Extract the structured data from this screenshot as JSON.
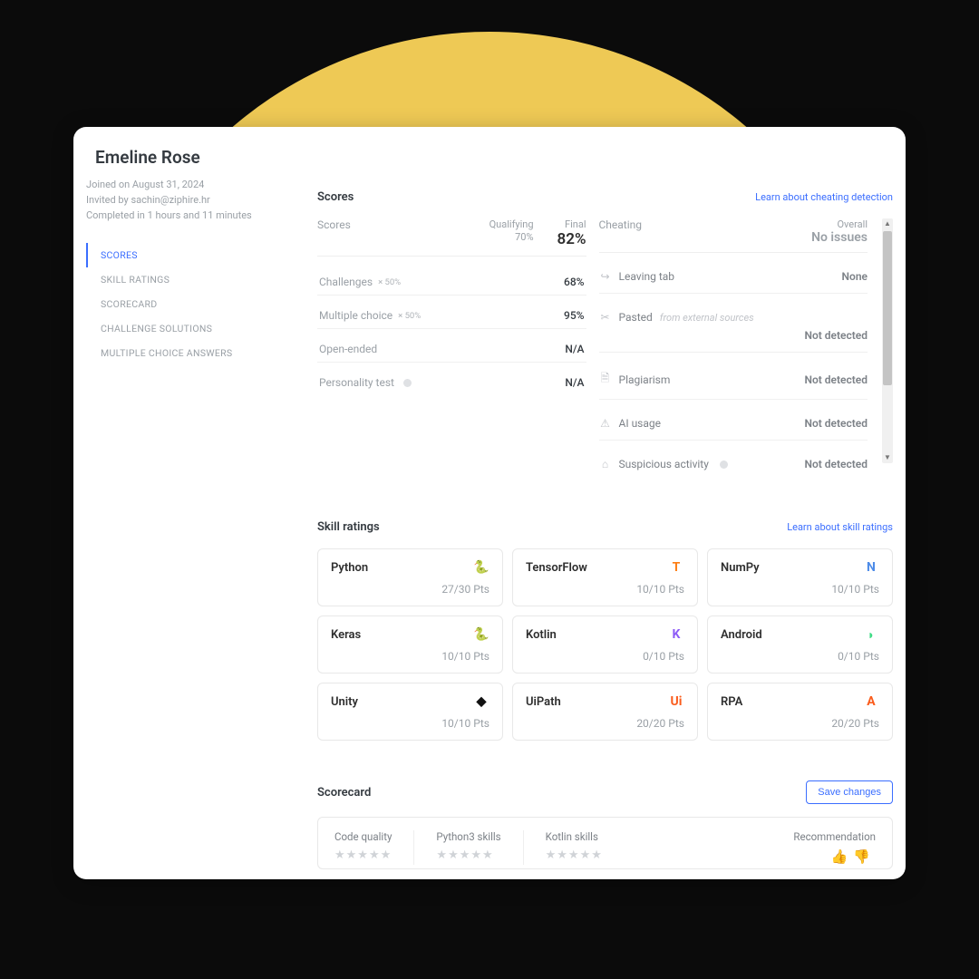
{
  "candidate": {
    "name": "Emeline Rose",
    "joined": "Joined on August 31, 2024",
    "invited": "Invited by sachin@ziphire.hr",
    "completed": "Completed in 1 hours and 11 minutes"
  },
  "sidenav": {
    "items": [
      {
        "label": "SCORES",
        "active": true
      },
      {
        "label": "SKILL RATINGS"
      },
      {
        "label": "SCORECARD"
      },
      {
        "label": "CHALLENGE SOLUTIONS"
      },
      {
        "label": "MULTIPLE CHOICE ANSWERS"
      }
    ]
  },
  "scores": {
    "title": "Scores",
    "learn": "Learn about cheating detection",
    "head": {
      "label": "Scores",
      "qualifying_label": "Qualifying",
      "qualifying": "70%",
      "final_label": "Final",
      "final": "82%"
    },
    "rows": [
      {
        "label": "Challenges",
        "weight": "× 50%",
        "value": "68%"
      },
      {
        "label": "Multiple choice",
        "weight": "× 50%",
        "value": "95%"
      },
      {
        "label": "Open-ended",
        "weight": "",
        "value": "N/A"
      },
      {
        "label": "Personality test",
        "weight": "",
        "value": "N/A",
        "info": true
      }
    ],
    "cheating": {
      "head_label": "Cheating",
      "overall_label": "Overall",
      "overall_value": "No issues",
      "items": [
        {
          "icon": "leaving-tab-icon",
          "glyph": "↪",
          "label": "Leaving tab",
          "value": "None"
        },
        {
          "icon": "pasted-icon",
          "glyph": "✂",
          "label": "Pasted",
          "sub": "from external sources",
          "value": "Not detected",
          "stacked": true
        },
        {
          "icon": "plagiarism-icon",
          "glyph": "🗎",
          "label": "Plagiarism",
          "value": "Not detected"
        },
        {
          "icon": "ai-usage-icon",
          "glyph": "⚠",
          "label": "AI usage",
          "value": "Not detected"
        },
        {
          "icon": "suspicious-activity-icon",
          "glyph": "⌂",
          "label": "Suspicious activity",
          "value": "Not detected",
          "info": true
        }
      ]
    }
  },
  "skills": {
    "title": "Skill ratings",
    "learn": "Learn about skill ratings",
    "cards": [
      {
        "name": "Python",
        "pts": "27/30 Pts",
        "glyph": "🐍",
        "color": "#ffb84d"
      },
      {
        "name": "TensorFlow",
        "pts": "10/10 Pts",
        "glyph": "T",
        "color": "#fd7e14"
      },
      {
        "name": "NumPy",
        "pts": "10/10 Pts",
        "glyph": "N",
        "color": "#4d8be8"
      },
      {
        "name": "Keras",
        "pts": "10/10 Pts",
        "glyph": "🐍",
        "color": "#ffb84d"
      },
      {
        "name": "Kotlin",
        "pts": "0/10 Pts",
        "glyph": "K",
        "color": "#8e5cf7"
      },
      {
        "name": "Android",
        "pts": "0/10 Pts",
        "glyph": "◗",
        "color": "#3ddc84"
      },
      {
        "name": "Unity",
        "pts": "10/10 Pts",
        "glyph": "◆",
        "color": "#111111"
      },
      {
        "name": "UiPath",
        "pts": "20/20 Pts",
        "glyph": "Ui",
        "color": "#fa5c1c"
      },
      {
        "name": "RPA",
        "pts": "20/20 Pts",
        "glyph": "A",
        "color": "#fa5c1c"
      }
    ]
  },
  "scorecard": {
    "title": "Scorecard",
    "save_label": "Save changes",
    "cols": [
      {
        "label": "Code quality"
      },
      {
        "label": "Python3 skills"
      },
      {
        "label": "Kotlin skills"
      }
    ],
    "recommendation_label": "Recommendation"
  }
}
